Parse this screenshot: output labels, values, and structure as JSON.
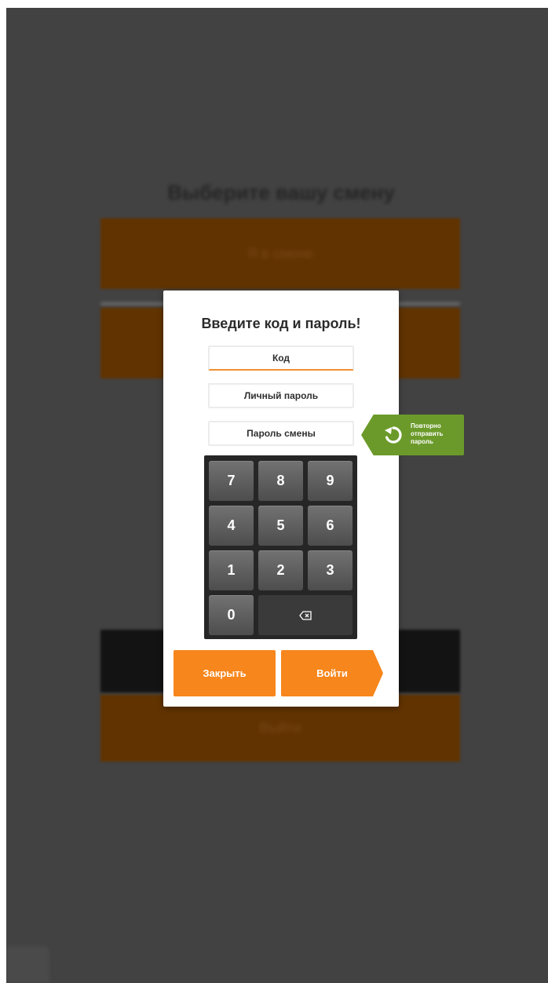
{
  "background": {
    "title": "Выберите вашу смену",
    "button_top_label": "Я в смене",
    "button_bottom_label": "Выйти"
  },
  "modal": {
    "title": "Введите код и пароль!",
    "fields": {
      "code_placeholder": "Код",
      "personal_password_placeholder": "Личный пароль",
      "shift_password_placeholder": "Пароль смены"
    },
    "keypad": {
      "keys": [
        "7",
        "8",
        "9",
        "4",
        "5",
        "6",
        "1",
        "2",
        "3",
        "0"
      ],
      "backspace_icon": "backspace-icon"
    },
    "buttons": {
      "close_label": "Закрыть",
      "enter_label": "Войти"
    }
  },
  "resend": {
    "line1": "Повторно",
    "line2": "отправить",
    "line3": "пароль",
    "icon": "refresh-icon"
  },
  "colors": {
    "accent_orange": "#f7861c",
    "resend_green": "#6b9a2a",
    "overlay": "#424242",
    "keypad_bg": "#262626"
  }
}
